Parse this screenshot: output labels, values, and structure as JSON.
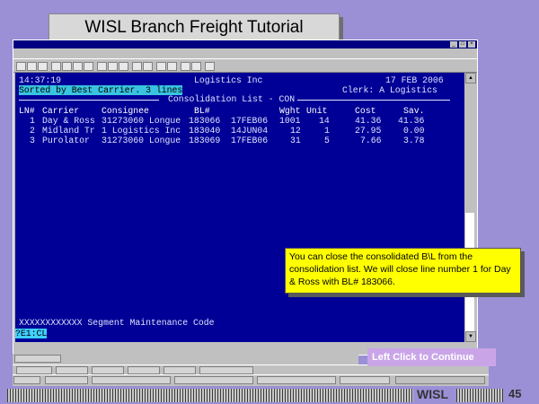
{
  "slide": {
    "title": "WISL Branch Freight Tutorial",
    "callout_text": "You can close the consolidated B\\L from the consolidation list. We will close line number 1 for Day & Ross with BL# 183066.",
    "continue_label": "Left Click to Continue",
    "footer_brand": "WISL",
    "page_number": "45"
  },
  "terminal": {
    "time": "14:37:19",
    "company": "Logistics Inc",
    "date": "17 FEB 2006",
    "sort_status": "Sorted by Best Carrier. 3 lines",
    "clerk": "Clerk: A Logistics",
    "screen_title": "Consolidation List - CON",
    "columns": {
      "ln": "LN#",
      "carrier": "Carrier",
      "consignee": "Consignee",
      "bl": "BL#",
      "wght": "Wght",
      "unit": "Unit",
      "cost": "Cost",
      "sav": "Sav."
    },
    "rows": [
      {
        "ln": "1",
        "carrier": "Day & Ross",
        "consignee": "31273060 Longue",
        "bl": "183066",
        "date": "17FEB06",
        "wght": "1001",
        "unit": "14",
        "cost": "41.36",
        "sav": "41.36"
      },
      {
        "ln": "2",
        "carrier": "Midland Tr",
        "consignee": "1 Logistics Inc",
        "bl": "183040",
        "date": "14JUN04",
        "wght": "12",
        "unit": "1",
        "cost": "27.95",
        "sav": "0.00"
      },
      {
        "ln": "3",
        "carrier": "Purolator",
        "consignee": "31273060 Longue",
        "bl": "183069",
        "date": "17FEB06",
        "wght": "31",
        "unit": "5",
        "cost": "7.66",
        "sav": "3.78"
      }
    ],
    "segment_code": "XXXXXXXXXXXX Segment Maintenance Code",
    "command_input": "?E1:CL"
  },
  "colors": {
    "terminal_bg": "#000096",
    "callout_bg": "#ffff00",
    "continue_bg": "#c9a5e8",
    "slide_bg": "#9b8fd6"
  }
}
